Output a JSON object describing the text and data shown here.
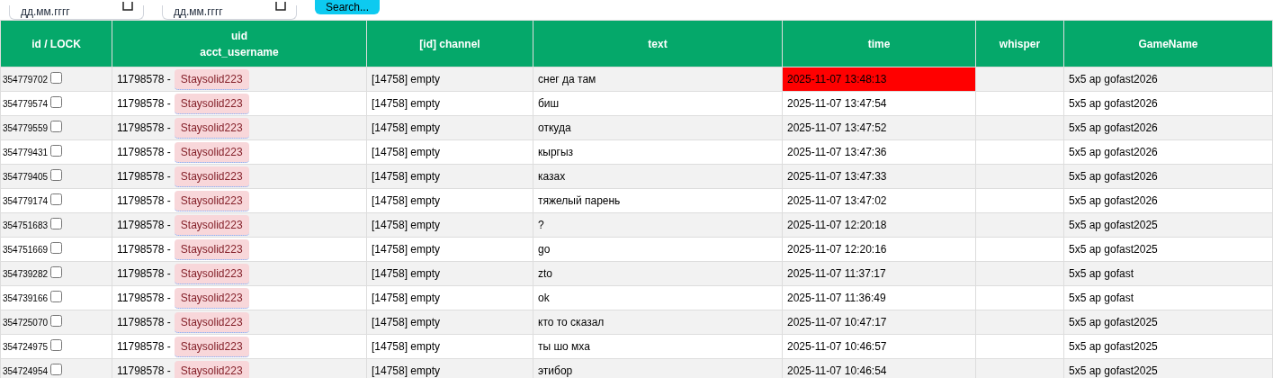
{
  "filters": {
    "date_from": {
      "placeholder": "дд.мм.гггг"
    },
    "date_to": {
      "placeholder": "дд.мм.гггг"
    },
    "search_button": "Search..."
  },
  "table": {
    "columns": [
      "id / LOCK",
      "uid\nacct_username",
      "[id] channel",
      "text",
      "time",
      "whisper",
      "GameName"
    ],
    "rows": [
      {
        "id": "354779702",
        "locked": false,
        "uid": "11798578 -",
        "username": "Staysolid223",
        "channel": "[14758] empty",
        "text": "снег да там",
        "time": "2025-11-07 13:48:13",
        "time_alert": true,
        "game": "5x5 ap gofast2026"
      },
      {
        "id": "354779574",
        "locked": false,
        "uid": "11798578 -",
        "username": "Staysolid223",
        "channel": "[14758] empty",
        "text": "биш",
        "time": "2025-11-07 13:47:54",
        "time_alert": false,
        "game": "5x5 ap gofast2026"
      },
      {
        "id": "354779559",
        "locked": false,
        "uid": "11798578 -",
        "username": "Staysolid223",
        "channel": "[14758] empty",
        "text": "откуда",
        "time": "2025-11-07 13:47:52",
        "time_alert": false,
        "game": "5x5 ap gofast2026"
      },
      {
        "id": "354779431",
        "locked": false,
        "uid": "11798578 -",
        "username": "Staysolid223",
        "channel": "[14758] empty",
        "text": "кыргыз",
        "time": "2025-11-07 13:47:36",
        "time_alert": false,
        "game": "5x5 ap gofast2026"
      },
      {
        "id": "354779405",
        "locked": false,
        "uid": "11798578 -",
        "username": "Staysolid223",
        "channel": "[14758] empty",
        "text": "казах",
        "time": "2025-11-07 13:47:33",
        "time_alert": false,
        "game": "5x5 ap gofast2026"
      },
      {
        "id": "354779174",
        "locked": false,
        "uid": "11798578 -",
        "username": "Staysolid223",
        "channel": "[14758] empty",
        "text": "тяжелый парень",
        "time": "2025-11-07 13:47:02",
        "time_alert": false,
        "game": "5x5 ap gofast2026"
      },
      {
        "id": "354751683",
        "locked": false,
        "uid": "11798578 -",
        "username": "Staysolid223",
        "channel": "[14758] empty",
        "text": "?",
        "time": "2025-11-07 12:20:18",
        "time_alert": false,
        "game": "5x5 ap gofast2025"
      },
      {
        "id": "354751669",
        "locked": false,
        "uid": "11798578 -",
        "username": "Staysolid223",
        "channel": "[14758] empty",
        "text": "go",
        "time": "2025-11-07 12:20:16",
        "time_alert": false,
        "game": "5x5 ap gofast2025"
      },
      {
        "id": "354739282",
        "locked": false,
        "uid": "11798578 -",
        "username": "Staysolid223",
        "channel": "[14758] empty",
        "text": "zto",
        "time": "2025-11-07 11:37:17",
        "time_alert": false,
        "game": "5x5 ap gofast"
      },
      {
        "id": "354739166",
        "locked": false,
        "uid": "11798578 -",
        "username": "Staysolid223",
        "channel": "[14758] empty",
        "text": "ok",
        "time": "2025-11-07 11:36:49",
        "time_alert": false,
        "game": "5x5 ap gofast"
      },
      {
        "id": "354725070",
        "locked": false,
        "uid": "11798578 -",
        "username": "Staysolid223",
        "channel": "[14758] empty",
        "text": "кто то сказал",
        "time": "2025-11-07 10:47:17",
        "time_alert": false,
        "game": "5x5 ap gofast2025"
      },
      {
        "id": "354724975",
        "locked": false,
        "uid": "11798578 -",
        "username": "Staysolid223",
        "channel": "[14758] empty",
        "text": "ты шо мха",
        "time": "2025-11-07 10:46:57",
        "time_alert": false,
        "game": "5x5 ap gofast2025"
      },
      {
        "id": "354724954",
        "locked": false,
        "uid": "11798578 -",
        "username": "Staysolid223",
        "channel": "[14758] empty",
        "text": "этибор",
        "time": "2025-11-07 10:46:54",
        "time_alert": false,
        "game": "5x5 ap gofast2025"
      }
    ]
  }
}
